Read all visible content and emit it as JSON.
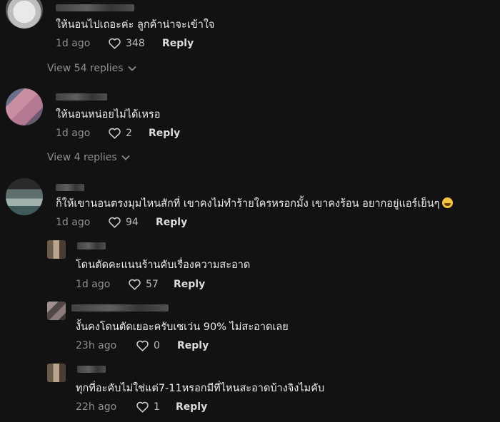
{
  "comments": [
    {
      "text": "ให้นอนไปเถอะค่ะ ลูกค้าน่าจะเข้าใจ",
      "time": "1d ago",
      "likes": "348",
      "reply": "Reply"
    },
    {
      "text": "ให้นอนหน่อยไม่ได้เหรอ",
      "time": "1d ago",
      "likes": "2",
      "reply": "Reply"
    },
    {
      "text": "ก็ให้เขานอนตรงมุมไหนสักที่ เขาคงไม่ทำร้ายใครหรอกมั้ง เขาคงร้อน อยากอยู่แอร์เย็นๆ",
      "emoji": "grinning-face-emoji",
      "time": "1d ago",
      "likes": "94",
      "reply": "Reply"
    },
    {
      "text": "โดนตัดคะแนนร้านคับเรื่องความสะอาด",
      "time": "1d ago",
      "likes": "57",
      "reply": "Reply"
    },
    {
      "text": "งั้นคงโดนตัดเยอะครับเซเว่น 90% ไม่สะอาดเลย",
      "time": "23h ago",
      "likes": "0",
      "reply": "Reply"
    },
    {
      "text": "ทุกที่อะคับไม่ใช่แต่7-11หรอกมีที่ไหนสะอาดบ้างจิงไมคับ",
      "time": "22h ago",
      "likes": "1",
      "reply": "Reply"
    }
  ],
  "view_replies": [
    {
      "label": "View 54 replies"
    },
    {
      "label": "View 4 replies"
    }
  ],
  "icons": {
    "like": "heart-outline-icon",
    "expand": "chevron-down-icon"
  },
  "colors": {
    "background": "#121212",
    "text": "#eeeeee",
    "meta": "#8f8f8f"
  }
}
